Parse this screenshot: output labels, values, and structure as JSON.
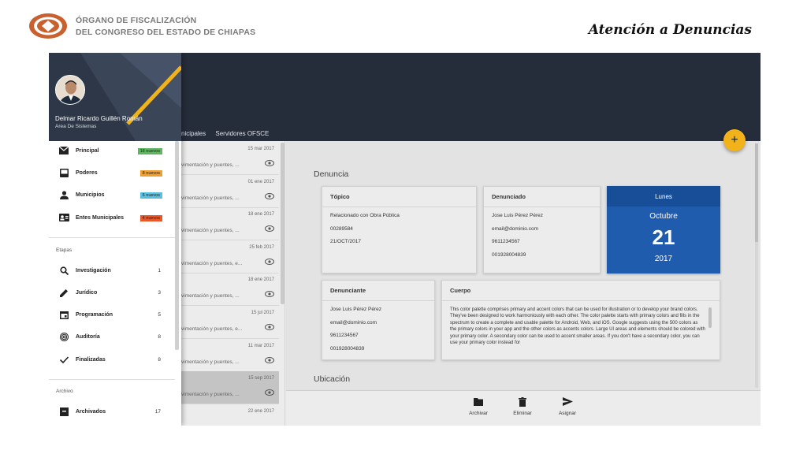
{
  "header": {
    "org_line1": "ÓRGANO DE FISCALIZACIÓN",
    "org_line2": "DEL CONGRESO DEL ESTADO DE CHIAPAS",
    "slide_title": "Atención a Denuncias"
  },
  "colors": {
    "topbar": "#252c3a",
    "accent_stripe": "#f2b31a",
    "fab": "#f2b31a",
    "date_card": "#1f5cad",
    "badge_principal": "#5cb85c",
    "badge_poderes": "#f0a030",
    "badge_municipios": "#5bc0de",
    "badge_entes": "#e8562a"
  },
  "topbar": {
    "tab_municipales": "nicipales",
    "tab_servidores": "Servidores OFSCE",
    "fab_label": "+"
  },
  "drawer": {
    "user_name": "Delmar Ricardo Guillén Román",
    "user_area": "Area De Sistemas",
    "main_items": [
      {
        "label": "Principal",
        "badge": "18 nuevos",
        "icon": "mail-icon"
      },
      {
        "label": "Poderes",
        "badge": "8 nuevos",
        "icon": "inbox-icon"
      },
      {
        "label": "Municipios",
        "badge": "6 nuevos",
        "icon": "person-icon"
      },
      {
        "label": "Entes Municipales",
        "badge": "4 nuevos",
        "icon": "contact-card-icon"
      }
    ],
    "etapas_label": "Etapas",
    "etapas": [
      {
        "label": "Investigación",
        "count": "1",
        "icon": "search-icon"
      },
      {
        "label": "Jurídico",
        "count": "3",
        "icon": "pencil-icon"
      },
      {
        "label": "Programación",
        "count": "5",
        "icon": "calendar-icon"
      },
      {
        "label": "Auditoría",
        "count": "8",
        "icon": "fingerprint-icon"
      },
      {
        "label": "Finalizadas",
        "count": "8",
        "icon": "check-icon"
      }
    ],
    "archivo_label": "Archivo",
    "archivo": [
      {
        "label": "Archivados",
        "count": "17",
        "icon": "archive-box-icon"
      }
    ]
  },
  "messages": [
    {
      "date": "15 mar 2017",
      "snippet": "vimentación y puentes, ..."
    },
    {
      "date": "01 ene 2017",
      "snippet": "vimentación y puentes, ..."
    },
    {
      "date": "18 ene 2017",
      "snippet": "vimentación y puentes, ..."
    },
    {
      "date": "25 feb 2017",
      "snippet": "vimentación y puentes, e..."
    },
    {
      "date": "18 ene 2017",
      "snippet": "vimentación y puentes, ..."
    },
    {
      "date": "15 jul 2017",
      "snippet": "vimentación y puentes, e..."
    },
    {
      "date": "11 mar 2017",
      "snippet": "vimentación y puentes, ..."
    },
    {
      "date": "15 sep 2017",
      "snippet": "vimentación y puentes, ..."
    },
    {
      "date": "22 ene 2017",
      "snippet": ""
    }
  ],
  "detail": {
    "denuncia_title": "Denuncia",
    "ubicacion_title": "Ubicación",
    "topico": {
      "title": "Tópico",
      "lines": [
        "Relacionado con Obra Pública",
        "00289584",
        "21/OCT/2017"
      ]
    },
    "denunciado": {
      "title": "Denunciado",
      "lines": [
        "Jose Luis Pérez Pérez",
        "email@dominio.com",
        "9611234567",
        "001928004839"
      ]
    },
    "date": {
      "weekday": "Lunes",
      "month": "Octubre",
      "day": "21",
      "year": "2017"
    },
    "denunciante": {
      "title": "Denunciante",
      "lines": [
        "Jose Luis Pérez Pérez",
        "email@dominio.com",
        "9611234567",
        "001928004839"
      ]
    },
    "cuerpo": {
      "title": "Cuerpo",
      "text": "This color palette comprises primary and accent colors that can be used for illustration or to develop your brand colors. They've been designed to work harmoniously with each other. The color palette starts with primary colors and fills in the spectrum to create a complete and usable palette for Android, Web, and iOS. Google suggests using the 500 colors as the primary colors in your app and the other colors as accents colors. Large UI areas and elements should be colored with your primary color. A secondary color can be used to accent smaller areas. If you don't have a secondary color, you can use your primary color instead for"
    }
  },
  "actions": [
    {
      "label": "Archivar",
      "icon": "folder-icon"
    },
    {
      "label": "Eliminar",
      "icon": "trash-icon"
    },
    {
      "label": "Asignar",
      "icon": "send-icon"
    }
  ]
}
